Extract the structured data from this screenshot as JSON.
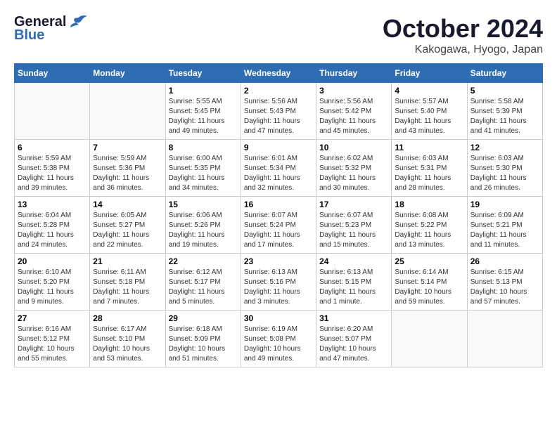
{
  "header": {
    "logo_general": "General",
    "logo_blue": "Blue",
    "month_title": "October 2024",
    "location": "Kakogawa, Hyogo, Japan"
  },
  "days_of_week": [
    "Sunday",
    "Monday",
    "Tuesday",
    "Wednesday",
    "Thursday",
    "Friday",
    "Saturday"
  ],
  "weeks": [
    [
      {
        "day": "",
        "empty": true
      },
      {
        "day": "",
        "empty": true
      },
      {
        "day": "1",
        "sunrise": "Sunrise: 5:55 AM",
        "sunset": "Sunset: 5:45 PM",
        "daylight": "Daylight: 11 hours and 49 minutes."
      },
      {
        "day": "2",
        "sunrise": "Sunrise: 5:56 AM",
        "sunset": "Sunset: 5:43 PM",
        "daylight": "Daylight: 11 hours and 47 minutes."
      },
      {
        "day": "3",
        "sunrise": "Sunrise: 5:56 AM",
        "sunset": "Sunset: 5:42 PM",
        "daylight": "Daylight: 11 hours and 45 minutes."
      },
      {
        "day": "4",
        "sunrise": "Sunrise: 5:57 AM",
        "sunset": "Sunset: 5:40 PM",
        "daylight": "Daylight: 11 hours and 43 minutes."
      },
      {
        "day": "5",
        "sunrise": "Sunrise: 5:58 AM",
        "sunset": "Sunset: 5:39 PM",
        "daylight": "Daylight: 11 hours and 41 minutes."
      }
    ],
    [
      {
        "day": "6",
        "sunrise": "Sunrise: 5:59 AM",
        "sunset": "Sunset: 5:38 PM",
        "daylight": "Daylight: 11 hours and 39 minutes."
      },
      {
        "day": "7",
        "sunrise": "Sunrise: 5:59 AM",
        "sunset": "Sunset: 5:36 PM",
        "daylight": "Daylight: 11 hours and 36 minutes."
      },
      {
        "day": "8",
        "sunrise": "Sunrise: 6:00 AM",
        "sunset": "Sunset: 5:35 PM",
        "daylight": "Daylight: 11 hours and 34 minutes."
      },
      {
        "day": "9",
        "sunrise": "Sunrise: 6:01 AM",
        "sunset": "Sunset: 5:34 PM",
        "daylight": "Daylight: 11 hours and 32 minutes."
      },
      {
        "day": "10",
        "sunrise": "Sunrise: 6:02 AM",
        "sunset": "Sunset: 5:32 PM",
        "daylight": "Daylight: 11 hours and 30 minutes."
      },
      {
        "day": "11",
        "sunrise": "Sunrise: 6:03 AM",
        "sunset": "Sunset: 5:31 PM",
        "daylight": "Daylight: 11 hours and 28 minutes."
      },
      {
        "day": "12",
        "sunrise": "Sunrise: 6:03 AM",
        "sunset": "Sunset: 5:30 PM",
        "daylight": "Daylight: 11 hours and 26 minutes."
      }
    ],
    [
      {
        "day": "13",
        "sunrise": "Sunrise: 6:04 AM",
        "sunset": "Sunset: 5:28 PM",
        "daylight": "Daylight: 11 hours and 24 minutes."
      },
      {
        "day": "14",
        "sunrise": "Sunrise: 6:05 AM",
        "sunset": "Sunset: 5:27 PM",
        "daylight": "Daylight: 11 hours and 22 minutes."
      },
      {
        "day": "15",
        "sunrise": "Sunrise: 6:06 AM",
        "sunset": "Sunset: 5:26 PM",
        "daylight": "Daylight: 11 hours and 19 minutes."
      },
      {
        "day": "16",
        "sunrise": "Sunrise: 6:07 AM",
        "sunset": "Sunset: 5:24 PM",
        "daylight": "Daylight: 11 hours and 17 minutes."
      },
      {
        "day": "17",
        "sunrise": "Sunrise: 6:07 AM",
        "sunset": "Sunset: 5:23 PM",
        "daylight": "Daylight: 11 hours and 15 minutes."
      },
      {
        "day": "18",
        "sunrise": "Sunrise: 6:08 AM",
        "sunset": "Sunset: 5:22 PM",
        "daylight": "Daylight: 11 hours and 13 minutes."
      },
      {
        "day": "19",
        "sunrise": "Sunrise: 6:09 AM",
        "sunset": "Sunset: 5:21 PM",
        "daylight": "Daylight: 11 hours and 11 minutes."
      }
    ],
    [
      {
        "day": "20",
        "sunrise": "Sunrise: 6:10 AM",
        "sunset": "Sunset: 5:20 PM",
        "daylight": "Daylight: 11 hours and 9 minutes."
      },
      {
        "day": "21",
        "sunrise": "Sunrise: 6:11 AM",
        "sunset": "Sunset: 5:18 PM",
        "daylight": "Daylight: 11 hours and 7 minutes."
      },
      {
        "day": "22",
        "sunrise": "Sunrise: 6:12 AM",
        "sunset": "Sunset: 5:17 PM",
        "daylight": "Daylight: 11 hours and 5 minutes."
      },
      {
        "day": "23",
        "sunrise": "Sunrise: 6:13 AM",
        "sunset": "Sunset: 5:16 PM",
        "daylight": "Daylight: 11 hours and 3 minutes."
      },
      {
        "day": "24",
        "sunrise": "Sunrise: 6:13 AM",
        "sunset": "Sunset: 5:15 PM",
        "daylight": "Daylight: 11 hours and 1 minute."
      },
      {
        "day": "25",
        "sunrise": "Sunrise: 6:14 AM",
        "sunset": "Sunset: 5:14 PM",
        "daylight": "Daylight: 10 hours and 59 minutes."
      },
      {
        "day": "26",
        "sunrise": "Sunrise: 6:15 AM",
        "sunset": "Sunset: 5:13 PM",
        "daylight": "Daylight: 10 hours and 57 minutes."
      }
    ],
    [
      {
        "day": "27",
        "sunrise": "Sunrise: 6:16 AM",
        "sunset": "Sunset: 5:12 PM",
        "daylight": "Daylight: 10 hours and 55 minutes."
      },
      {
        "day": "28",
        "sunrise": "Sunrise: 6:17 AM",
        "sunset": "Sunset: 5:10 PM",
        "daylight": "Daylight: 10 hours and 53 minutes."
      },
      {
        "day": "29",
        "sunrise": "Sunrise: 6:18 AM",
        "sunset": "Sunset: 5:09 PM",
        "daylight": "Daylight: 10 hours and 51 minutes."
      },
      {
        "day": "30",
        "sunrise": "Sunrise: 6:19 AM",
        "sunset": "Sunset: 5:08 PM",
        "daylight": "Daylight: 10 hours and 49 minutes."
      },
      {
        "day": "31",
        "sunrise": "Sunrise: 6:20 AM",
        "sunset": "Sunset: 5:07 PM",
        "daylight": "Daylight: 10 hours and 47 minutes."
      },
      {
        "day": "",
        "empty": true
      },
      {
        "day": "",
        "empty": true
      }
    ]
  ]
}
